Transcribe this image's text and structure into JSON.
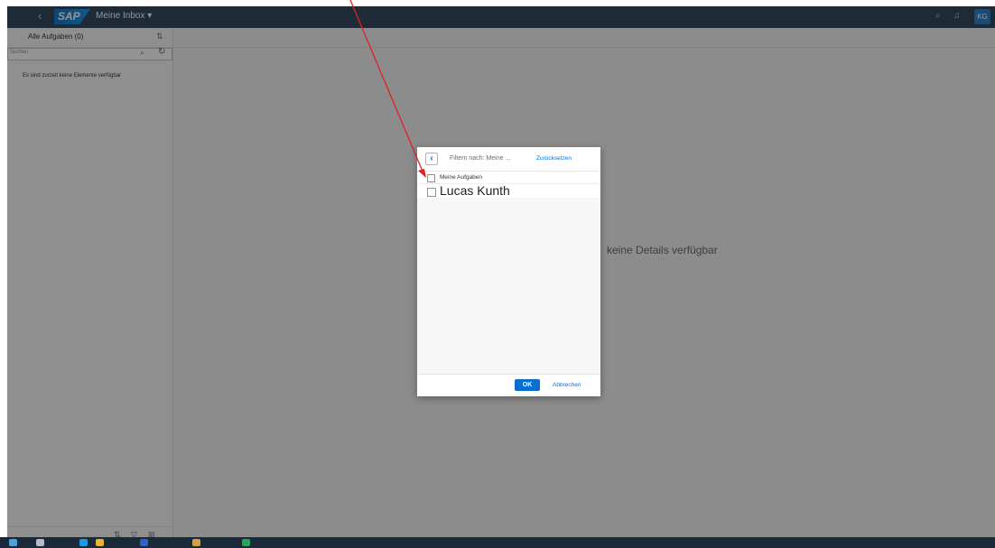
{
  "shell": {
    "back_icon": "back-icon",
    "logo_text": "SAP",
    "title": "Meine Inbox ▾",
    "search_icon": "search-icon",
    "bell_icon": "notification-bell-icon",
    "avatar": "KG"
  },
  "master": {
    "title": "Alle Aufgaben (0)",
    "search_placeholder": "Suchen",
    "empty_text": "Es sind zurzeit keine Elemente verfügbar",
    "sort_icon": "sort-icon"
  },
  "detail": {
    "no_details": "keine Details verfügbar"
  },
  "dialog": {
    "title": "Filtern nach: Meine ...",
    "reset": "Zurücksetzen",
    "select_all_label": "Meine Aufgaben",
    "items": [
      {
        "label": "Lucas Kunth"
      }
    ],
    "ok": "OK",
    "cancel": "Abbrechen"
  },
  "annotation_color": "#e02020"
}
